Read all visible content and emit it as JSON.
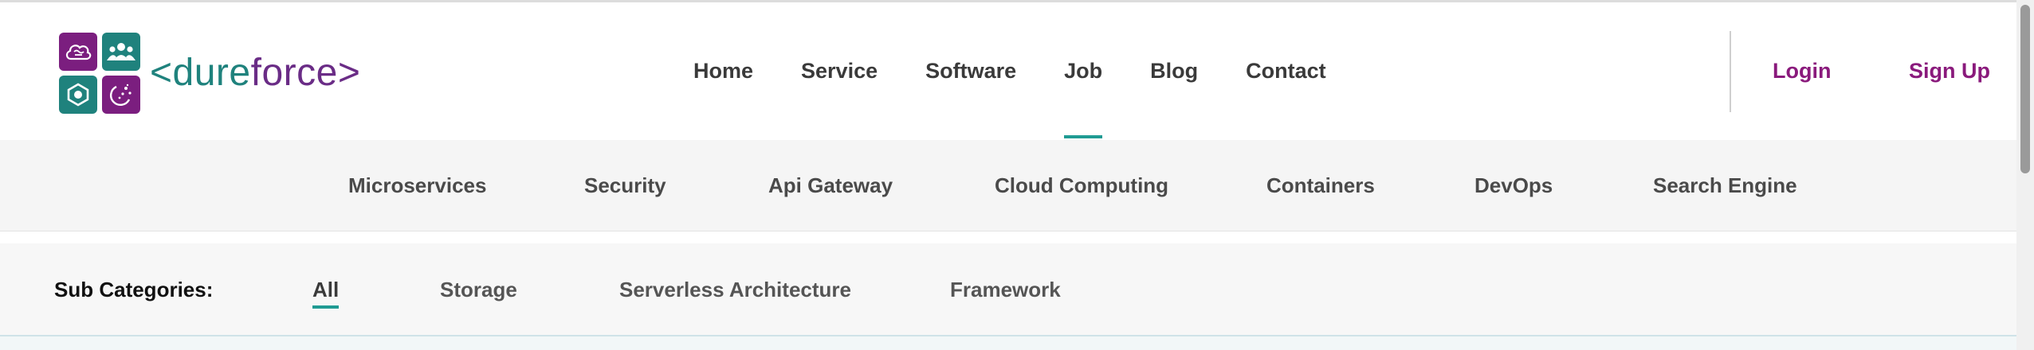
{
  "brand": {
    "logo_text_prefix": "<",
    "logo_text_dure": "dure",
    "logo_text_force": "force",
    "logo_text_suffix": ">",
    "colors": {
      "teal": "#1f827d",
      "purple": "#7b1e7f",
      "accent_underline": "#1f9b93",
      "auth_purple": "#8a1a7c"
    },
    "tile_icons": [
      "cloud-brain-icon",
      "people-icon",
      "hexagon-gear-icon",
      "sparkle-circle-icon"
    ]
  },
  "main_nav": {
    "items": [
      {
        "label": "Home"
      },
      {
        "label": "Service"
      },
      {
        "label": "Software"
      },
      {
        "label": "Job",
        "active": true
      },
      {
        "label": "Blog"
      },
      {
        "label": "Contact"
      }
    ]
  },
  "auth": {
    "login": "Login",
    "signup": "Sign Up"
  },
  "categories": {
    "items": [
      {
        "label": "Microservices"
      },
      {
        "label": "Security"
      },
      {
        "label": "Api Gateway"
      },
      {
        "label": "Cloud Computing"
      },
      {
        "label": "Containers"
      },
      {
        "label": "DevOps"
      },
      {
        "label": "Search Engine"
      }
    ]
  },
  "sub_categories": {
    "label": "Sub Categories",
    "label_suffix": ":",
    "items": [
      {
        "label": "All",
        "active": true
      },
      {
        "label": "Storage"
      },
      {
        "label": "Serverless Architecture"
      },
      {
        "label": "Framework"
      }
    ]
  }
}
